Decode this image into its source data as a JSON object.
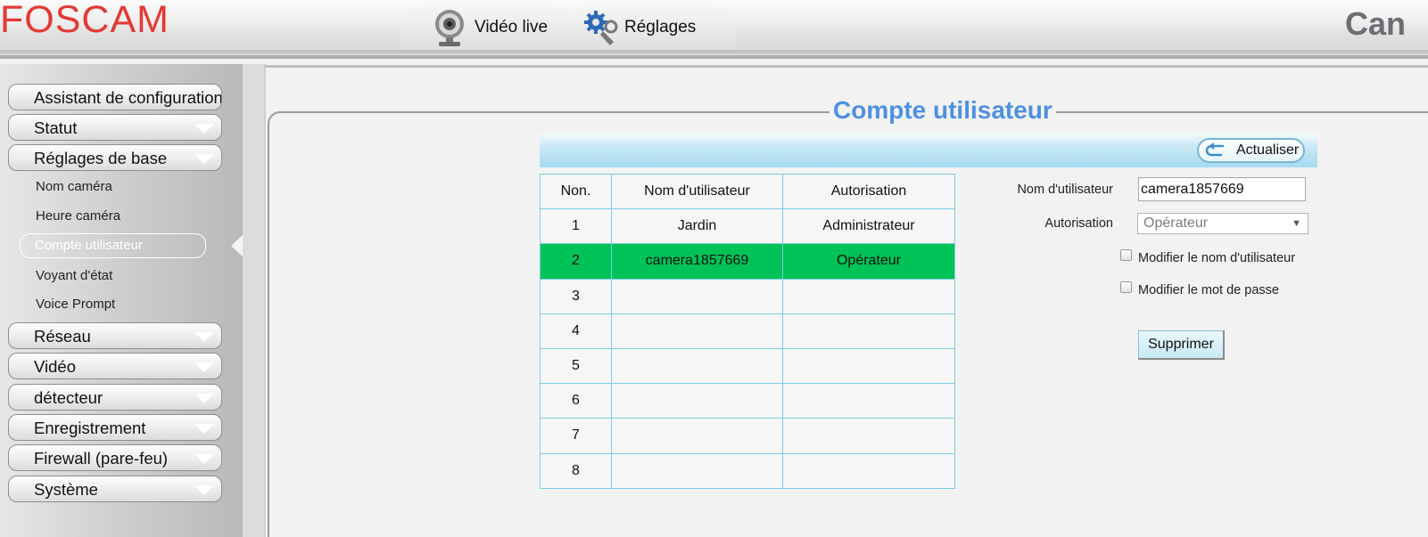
{
  "header": {
    "logo_text": "FOSCAM",
    "brand_partial": "Can",
    "tabs": [
      {
        "label": "Vidéo live",
        "icon": "webcam-icon"
      },
      {
        "label": "Réglages",
        "icon": "gears-icon"
      }
    ]
  },
  "sidebar": {
    "items": [
      {
        "label": "Assistant de configuration",
        "has_chevron": false
      },
      {
        "label": "Statut",
        "has_chevron": true
      },
      {
        "label": "Réglages de base",
        "has_chevron": true,
        "expanded": true
      },
      {
        "label": "Réseau",
        "has_chevron": true
      },
      {
        "label": "Vidéo",
        "has_chevron": true
      },
      {
        "label": "détecteur",
        "has_chevron": true
      },
      {
        "label": "Enregistrement",
        "has_chevron": true
      },
      {
        "label": "Firewall (pare-feu)",
        "has_chevron": true
      },
      {
        "label": "Système",
        "has_chevron": true
      }
    ],
    "sub_items": [
      {
        "label": "Nom caméra"
      },
      {
        "label": "Heure caméra"
      },
      {
        "label": "Compte utilisateur",
        "active": true
      },
      {
        "label": "Voyant d'état"
      },
      {
        "label": "Voice Prompt"
      }
    ]
  },
  "main": {
    "title": "Compte utilisateur",
    "refresh_label": "Actualiser",
    "table": {
      "headers": [
        "Non.",
        "Nom d'utilisateur",
        "Autorisation"
      ],
      "rows": [
        {
          "no": "1",
          "user": "Jardin",
          "auth": "Administrateur",
          "selected": false
        },
        {
          "no": "2",
          "user": "camera1857669",
          "auth": "Opérateur",
          "selected": true
        },
        {
          "no": "3",
          "user": "",
          "auth": "",
          "selected": false
        },
        {
          "no": "4",
          "user": "",
          "auth": "",
          "selected": false
        },
        {
          "no": "5",
          "user": "",
          "auth": "",
          "selected": false
        },
        {
          "no": "6",
          "user": "",
          "auth": "",
          "selected": false
        },
        {
          "no": "7",
          "user": "",
          "auth": "",
          "selected": false
        },
        {
          "no": "8",
          "user": "",
          "auth": "",
          "selected": false
        }
      ]
    },
    "form": {
      "username_label": "Nom d'utilisateur",
      "username_value": "camera1857669",
      "auth_label": "Autorisation",
      "auth_value": "Opérateur",
      "modify_username_label": "Modifier le nom d'utilisateur",
      "modify_password_label": "Modifier le mot de passe",
      "delete_label": "Supprimer"
    }
  },
  "colors": {
    "logo": "#e23a35",
    "title": "#4e90e0",
    "selected_row": "#00c357",
    "table_border": "#7ccbe6"
  }
}
